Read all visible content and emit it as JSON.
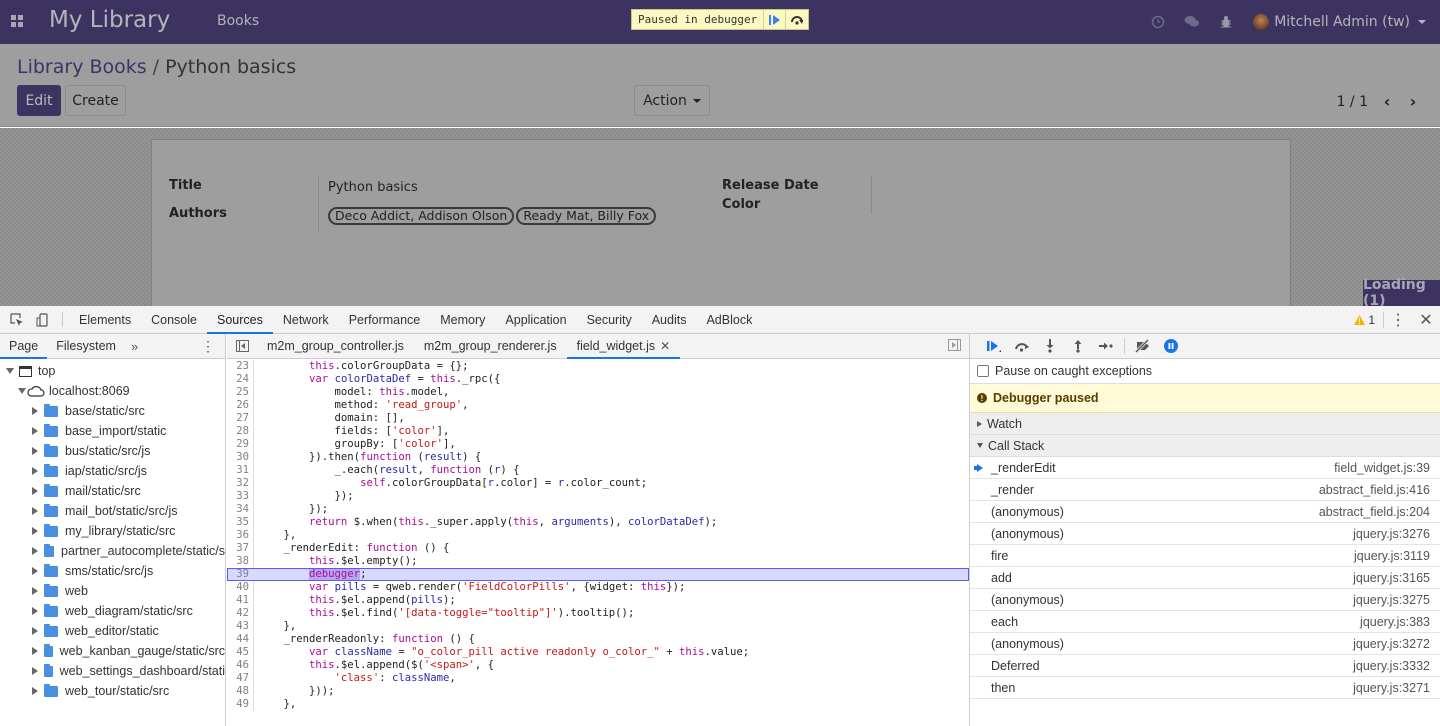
{
  "navbar": {
    "app_name": "My Library",
    "menu_item": "Books",
    "debugger_banner": "Paused in debugger",
    "user": "Mitchell Admin (tw)",
    "icons": [
      "apps-icon",
      "clock-icon",
      "chat-icon",
      "bug-icon",
      "avatar",
      "caret-down-icon"
    ]
  },
  "control_panel": {
    "breadcrumb_parent": "Library Books",
    "breadcrumb_separator": "/",
    "breadcrumb_current": "Python basics",
    "edit_label": "Edit",
    "create_label": "Create",
    "action_label": "Action",
    "pager": "1 / 1"
  },
  "form": {
    "title_label": "Title",
    "title_value": "Python basics",
    "authors_label": "Authors",
    "authors": [
      "Deco Addict, Addison Olson",
      "Ready Mat, Billy Fox"
    ],
    "release_date_label": "Release Date",
    "color_label": "Color"
  },
  "loading_indicator": "Loading (1)",
  "devtools": {
    "tabs": [
      "Elements",
      "Console",
      "Sources",
      "Network",
      "Performance",
      "Memory",
      "Application",
      "Security",
      "Audits",
      "AdBlock"
    ],
    "active_tab": "Sources",
    "warnings_count": "1",
    "navigator": {
      "tabs": [
        "Page",
        "Filesystem"
      ],
      "more": "»",
      "root": "top",
      "host": "localhost:8069",
      "folders": [
        "base/static/src",
        "base_import/static",
        "bus/static/src/js",
        "iap/static/src/js",
        "mail/static/src",
        "mail_bot/static/src/js",
        "my_library/static/src",
        "partner_autocomplete/static/s",
        "sms/static/src/js",
        "web",
        "web_diagram/static/src",
        "web_editor/static",
        "web_kanban_gauge/static/src",
        "web_settings_dashboard/stati",
        "web_tour/static/src"
      ]
    },
    "editor": {
      "tabs": [
        "m2m_group_controller.js",
        "m2m_group_renderer.js",
        "field_widget.js"
      ],
      "active_tab": "field_widget.js",
      "paused_line": 39,
      "lines": [
        {
          "n": 23,
          "code": "        this.colorGroupData = {};"
        },
        {
          "n": 24,
          "code": "        var colorDataDef = this._rpc({"
        },
        {
          "n": 25,
          "code": "            model: this.model,"
        },
        {
          "n": 26,
          "code": "            method: 'read_group',"
        },
        {
          "n": 27,
          "code": "            domain: [],"
        },
        {
          "n": 28,
          "code": "            fields: ['color'],"
        },
        {
          "n": 29,
          "code": "            groupBy: ['color'],"
        },
        {
          "n": 30,
          "code": "        }).then(function (result) {"
        },
        {
          "n": 31,
          "code": "            _.each(result, function (r) {"
        },
        {
          "n": 32,
          "code": "                self.colorGroupData[r.color] = r.color_count;"
        },
        {
          "n": 33,
          "code": "            });"
        },
        {
          "n": 34,
          "code": "        });"
        },
        {
          "n": 35,
          "code": "        return $.when(this._super.apply(this, arguments), colorDataDef);"
        },
        {
          "n": 36,
          "code": "    },"
        },
        {
          "n": 37,
          "code": "    _renderEdit: function () {"
        },
        {
          "n": 38,
          "code": "        this.$el.empty();"
        },
        {
          "n": 39,
          "code": "        debugger;"
        },
        {
          "n": 40,
          "code": "        var pills = qweb.render('FieldColorPills', {widget: this});"
        },
        {
          "n": 41,
          "code": "        this.$el.append(pills);"
        },
        {
          "n": 42,
          "code": "        this.$el.find('[data-toggle=\"tooltip\"]').tooltip();"
        },
        {
          "n": 43,
          "code": "    },"
        },
        {
          "n": 44,
          "code": "    _renderReadonly: function () {"
        },
        {
          "n": 45,
          "code": "        var className = \"o_color_pill active readonly o_color_\" + this.value;"
        },
        {
          "n": 46,
          "code": "        this.$el.append($('<span>', {"
        },
        {
          "n": 47,
          "code": "            'class': className,"
        },
        {
          "n": 48,
          "code": "        }));"
        },
        {
          "n": 49,
          "code": "    },"
        }
      ]
    },
    "sidebar": {
      "pause_on_caught": "Pause on caught exceptions",
      "pause_on_caught_checked": false,
      "paused_message": "Debugger paused",
      "watch_label": "Watch",
      "call_stack_label": "Call Stack",
      "call_stack": [
        {
          "fn": "_renderEdit",
          "loc": "field_widget.js:39",
          "current": true
        },
        {
          "fn": "_render",
          "loc": "abstract_field.js:416"
        },
        {
          "fn": "(anonymous)",
          "loc": "abstract_field.js:204"
        },
        {
          "fn": "(anonymous)",
          "loc": "jquery.js:3276"
        },
        {
          "fn": "fire",
          "loc": "jquery.js:3119"
        },
        {
          "fn": "add",
          "loc": "jquery.js:3165"
        },
        {
          "fn": "(anonymous)",
          "loc": "jquery.js:3275"
        },
        {
          "fn": "each",
          "loc": "jquery.js:383"
        },
        {
          "fn": "(anonymous)",
          "loc": "jquery.js:3272"
        },
        {
          "fn": "Deferred",
          "loc": "jquery.js:3332"
        },
        {
          "fn": "then",
          "loc": "jquery.js:3271"
        }
      ]
    }
  }
}
